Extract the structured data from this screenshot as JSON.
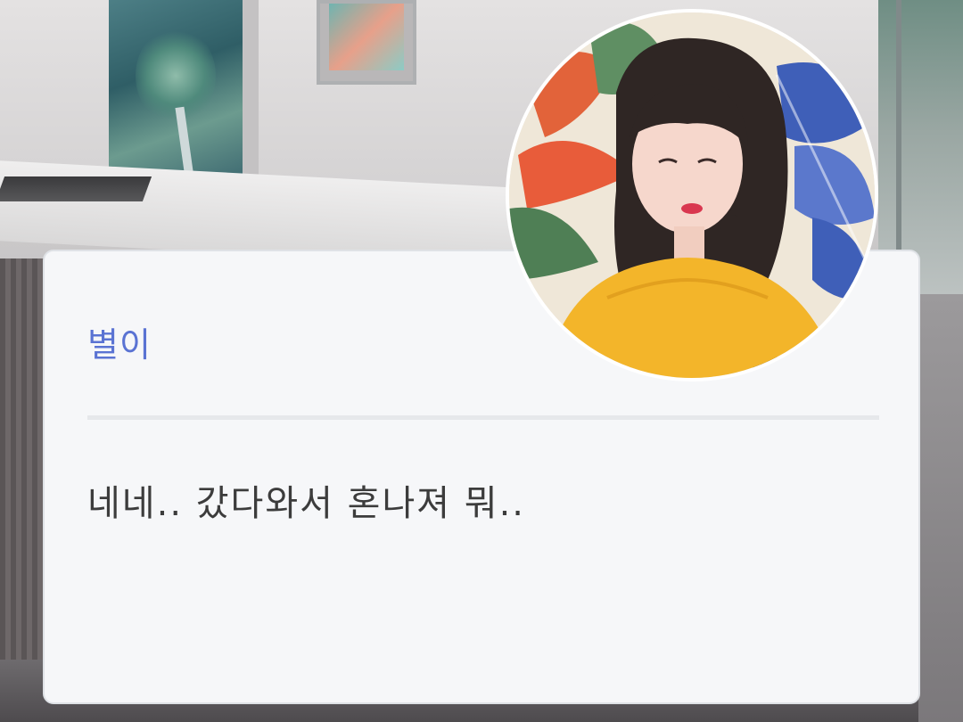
{
  "dialogue": {
    "speaker_name": "별이",
    "message": "네네.. 갔다와서 혼나져 뭐..",
    "speaker_color": "#5a73d3",
    "text_color": "#3c3c3c",
    "card_color": "#f6f7f9"
  },
  "avatar": {
    "description_icon": "character-portrait-icon",
    "sweater_color": "#f3b52a",
    "hair_color": "#2f2624"
  }
}
